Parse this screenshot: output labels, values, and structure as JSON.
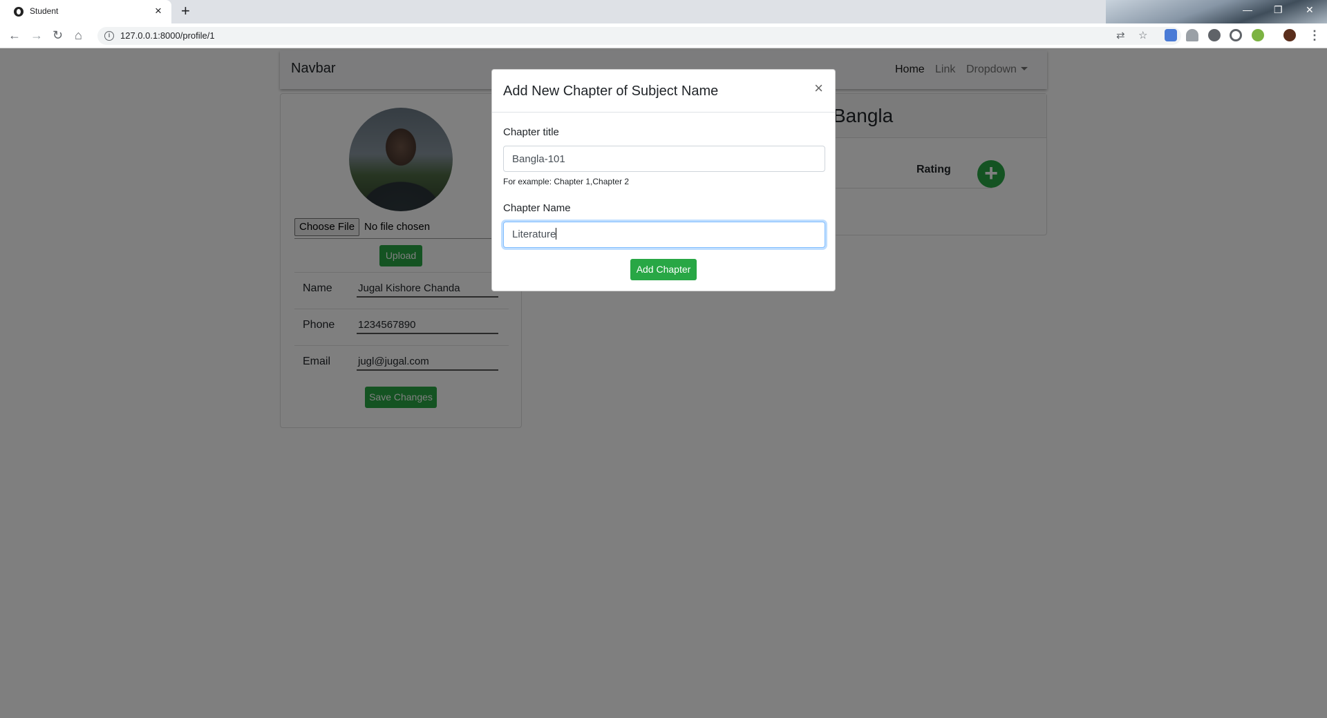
{
  "browser": {
    "tab_title": "Student",
    "tab_close": "×",
    "new_tab": "+",
    "url": "127.0.0.1:8000/profile/1",
    "info": "i",
    "minimize": "—",
    "maximize": "❐",
    "close": "✕"
  },
  "navbar": {
    "brand": "Navbar",
    "home": "Home",
    "link": "Link",
    "dropdown": "Dropdown"
  },
  "profile": {
    "choose_file": "Choose File",
    "no_file": "No file chosen",
    "upload": "Upload",
    "fields": [
      {
        "label": "Name",
        "value": "Jugal Kishore Chanda"
      },
      {
        "label": "Phone",
        "value": "1234567890"
      },
      {
        "label": "Email",
        "value": "jugl@jugal.com"
      }
    ],
    "save": "Save Changes"
  },
  "subject": {
    "title": "Bangla",
    "rating_header": "Rating",
    "add": "+"
  },
  "modal": {
    "title": "Add New Chapter of Subject Name",
    "close": "×",
    "chapter_title_label": "Chapter title",
    "chapter_title_value": "Bangla-101",
    "chapter_title_help": "For example: Chapter 1,Chapter 2",
    "chapter_name_label": "Chapter Name",
    "chapter_name_value": "Literature",
    "submit": "Add Chapter"
  },
  "colors": {
    "success": "#28a745",
    "backdrop": "rgba(0,0,0,0.5)",
    "focus_border": "#80bdff"
  }
}
